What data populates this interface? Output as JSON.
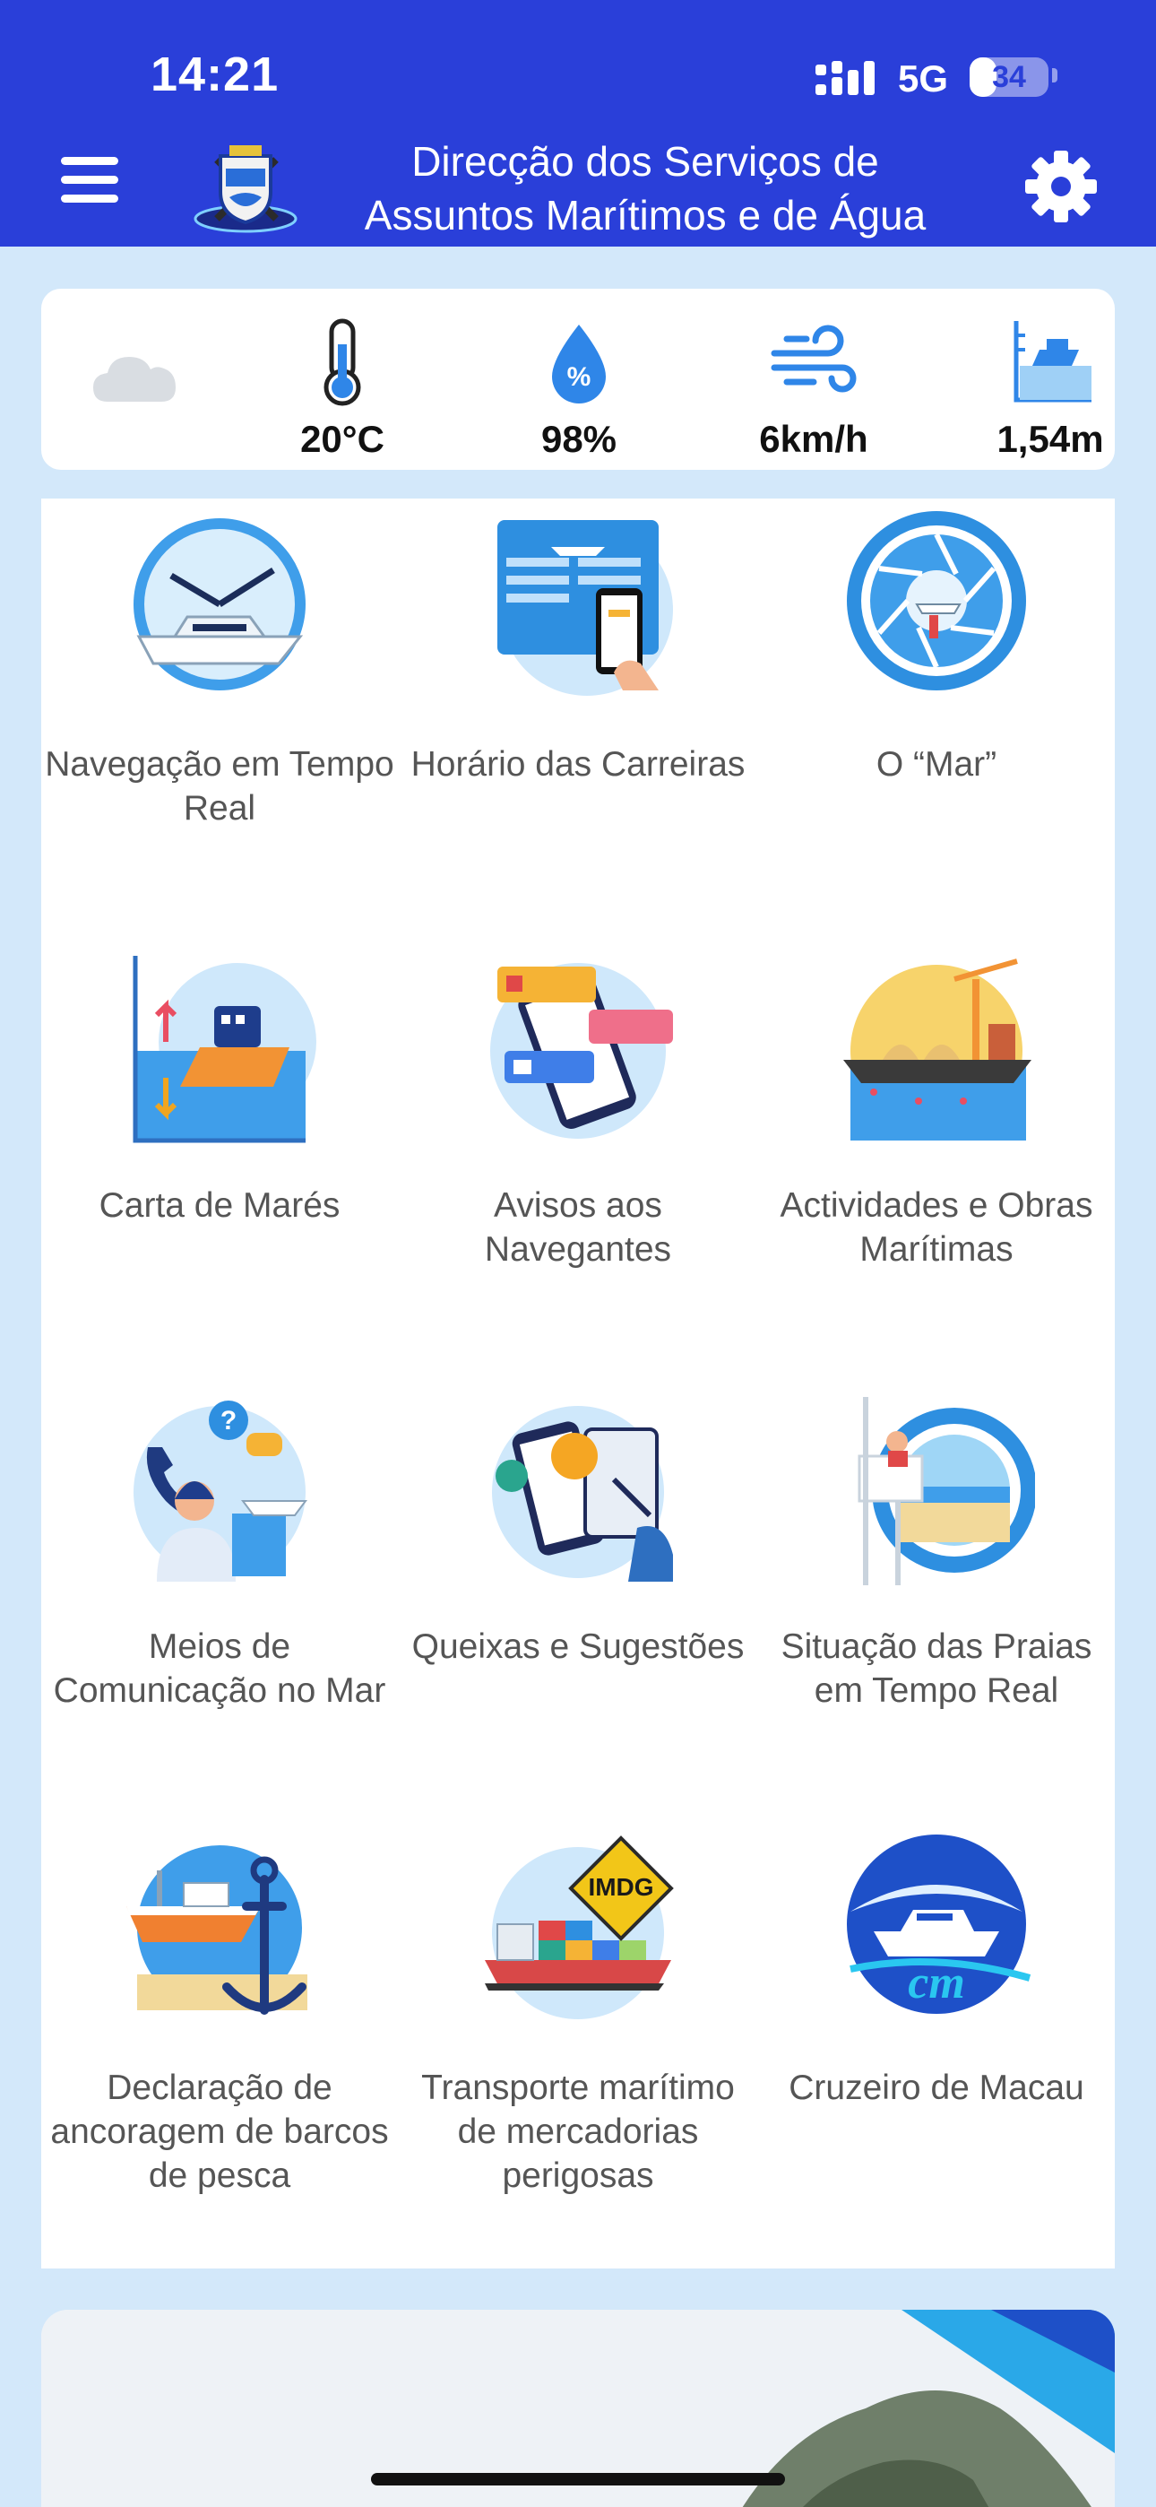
{
  "status_bar": {
    "time": "14:21",
    "network": "5G",
    "battery": "34",
    "battery_level_percent": 34
  },
  "header": {
    "title_line1": "Direcção dos Serviços de",
    "title_line2": "Assuntos Marítimos e de Água",
    "menu_icon": "hamburger-menu-icon",
    "settings_icon": "gear-icon",
    "background_color": "#2a3fd9"
  },
  "weather": {
    "condition_icon": "cloud-icon",
    "temperature": "20°C",
    "humidity": "98%",
    "wind": "6km/h",
    "tide": "1,54m"
  },
  "services": [
    {
      "label": "Navegação em Tempo Real",
      "icon": "clock-ship-icon"
    },
    {
      "label": "Horário das Carreiras",
      "icon": "ferry-schedule-icon"
    },
    {
      "label": "O “Mar”",
      "icon": "camera-shutter-ship-icon"
    },
    {
      "label": "Carta de Marés",
      "icon": "tide-chart-icon"
    },
    {
      "label": "Avisos aos Navegantes",
      "icon": "phone-notices-icon"
    },
    {
      "label": "Actividades e Obras Marítimas",
      "icon": "crane-barge-icon"
    },
    {
      "label": "Meios de Comunicação no Mar",
      "icon": "call-center-icon"
    },
    {
      "label": "Queixas e Sugestões",
      "icon": "feedback-icon"
    },
    {
      "label": "Situação das Praias em Tempo Real",
      "icon": "lifeguard-tower-icon"
    },
    {
      "label": "Declaração de ancoragem de barcos de pesca",
      "icon": "fishing-boat-anchor-icon"
    },
    {
      "label": "Transporte marítimo de mercadorias perigosas",
      "icon": "cargo-ship-imdg-icon",
      "badge": "IMDG"
    },
    {
      "label": "Cruzeiro de Macau",
      "icon": "cruise-logo-icon",
      "badge": "cm"
    }
  ]
}
